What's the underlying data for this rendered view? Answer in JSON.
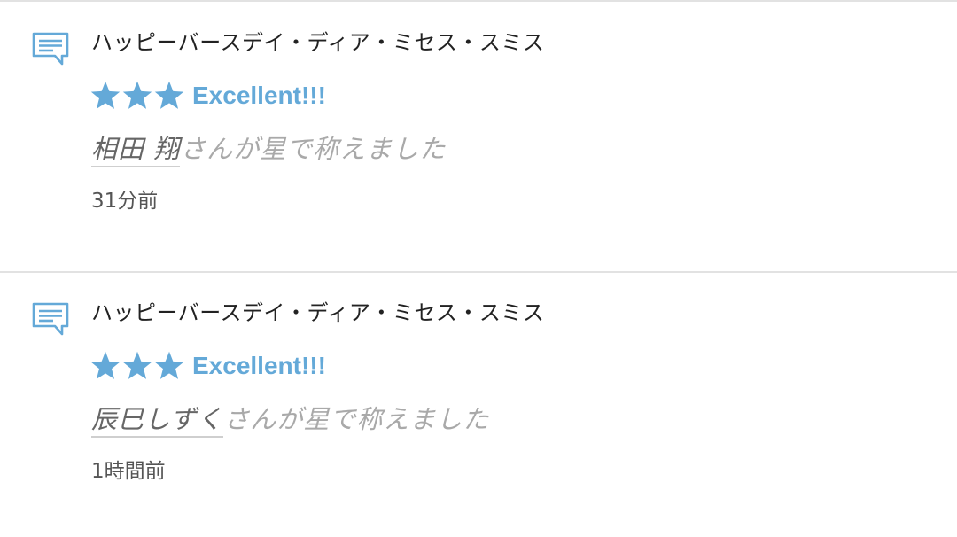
{
  "theme": {
    "accent": "#64a9d8",
    "divider": "#e2e2e2",
    "title_color": "#222222",
    "muted_text": "#a9a9a9",
    "user_text": "#666666"
  },
  "icons": {
    "comment": "comment-bubble-icon",
    "star": "star-icon"
  },
  "notifications": [
    {
      "title": "ハッピーバースデイ・ディア・ミセス・スミス",
      "stars": 3,
      "rating_label": "Excellent!!!",
      "user_name": "相田 翔",
      "action_text": "さんが星で称えました",
      "time": "31分前"
    },
    {
      "title": "ハッピーバースデイ・ディア・ミセス・スミス",
      "stars": 3,
      "rating_label": "Excellent!!!",
      "user_name": "辰巳しずく",
      "action_text": "さんが星で称えました",
      "time": "1時間前"
    }
  ]
}
